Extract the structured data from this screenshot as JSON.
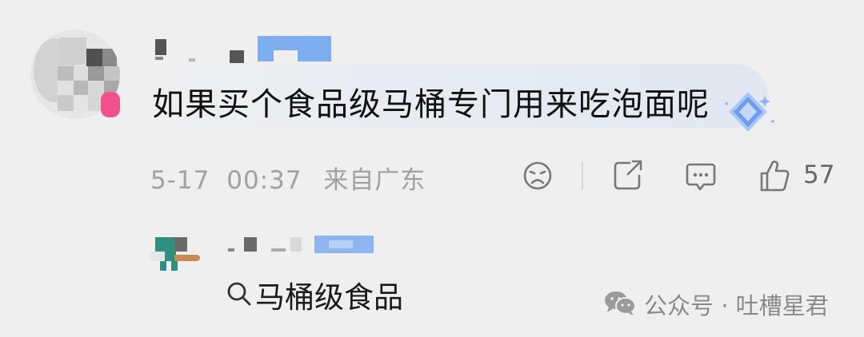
{
  "comment": {
    "text": "如果买个食品级马桶专门用来吃泡面呢",
    "date": "5-17",
    "time": "00:37",
    "location": "来自广东",
    "like_count": "57"
  },
  "actions": {
    "react_icon": "sad-face-icon",
    "share_icon": "share-icon",
    "reply_icon": "comment-icon",
    "like_icon": "thumbs-up-icon"
  },
  "reply": {
    "search_link": "马桶级食品"
  },
  "watermark": {
    "text": "公众号 · 吐槽星君"
  },
  "colors": {
    "background": "#efefef",
    "text": "#111111",
    "meta": "#a1a1a1",
    "highlight": "#7faef0",
    "badge": "#5b8fe8",
    "avatar_pink": "#f0508c"
  }
}
